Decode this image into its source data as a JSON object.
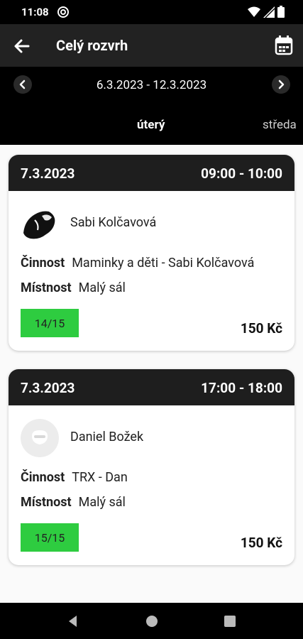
{
  "status": {
    "time": "11:08"
  },
  "header": {
    "title": "Celý rozvrh"
  },
  "week": {
    "range": "6.3.2023 - 12.3.2023"
  },
  "tabs": [
    {
      "label": "úterý"
    },
    {
      "label": "středa"
    }
  ],
  "labels": {
    "activity": "Činnost",
    "room": "Místnost"
  },
  "sessions": [
    {
      "date": "7.3.2023",
      "time": "09:00 - 10:00",
      "trainer": "Sabi Kolčavová",
      "activity": "Maminky a děti - Sabi Kolčavová",
      "room": "Malý sál",
      "capacity": "14/15",
      "price": "150 Kč"
    },
    {
      "date": "7.3.2023",
      "time": "17:00 - 18:00",
      "trainer": "Daniel Božek",
      "activity": "TRX - Dan",
      "room": "Malý sál",
      "capacity": "15/15",
      "price": "150 Kč"
    }
  ],
  "colors": {
    "capacity": "#2ecc40",
    "header": "#222222",
    "card_head": "#1e1e1e"
  }
}
